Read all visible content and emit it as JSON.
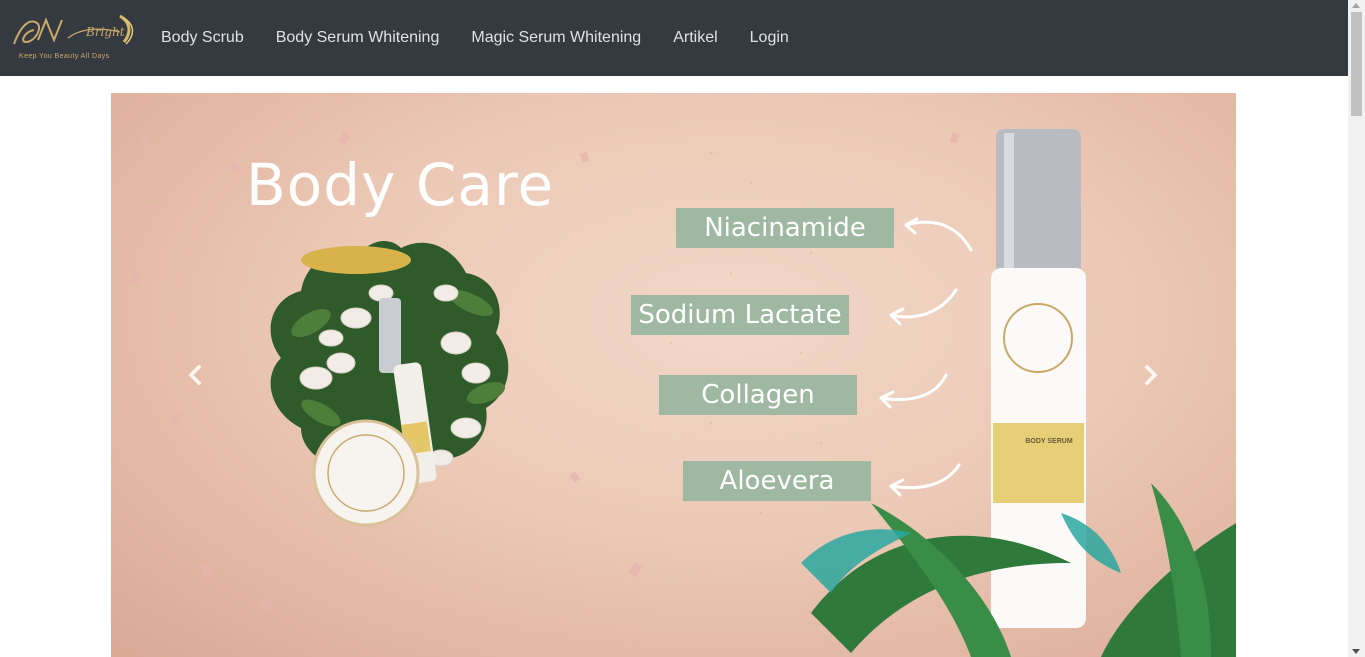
{
  "brand": {
    "logo_text": "AN Bright",
    "tagline": "Keep You Beauty All Days"
  },
  "nav": {
    "items": [
      {
        "label": "Body Scrub"
      },
      {
        "label": "Body Serum Whitening"
      },
      {
        "label": "Magic Serum Whitening"
      },
      {
        "label": "Artikel"
      },
      {
        "label": "Login"
      }
    ]
  },
  "carousel": {
    "slide": {
      "title": "Body Care",
      "ingredients": [
        "Niacinamide",
        "Sodium Lactate",
        "Collagen",
        "Aloevera"
      ],
      "bottle_label": "BODY SERUM"
    },
    "prev_icon": "chevron-left-icon",
    "next_icon": "chevron-right-icon"
  },
  "colors": {
    "navbar_bg": "#343a40",
    "tag_green": "#9fb8a2",
    "slide_bg": "#ecc9b6",
    "gold": "#c9a96a"
  }
}
